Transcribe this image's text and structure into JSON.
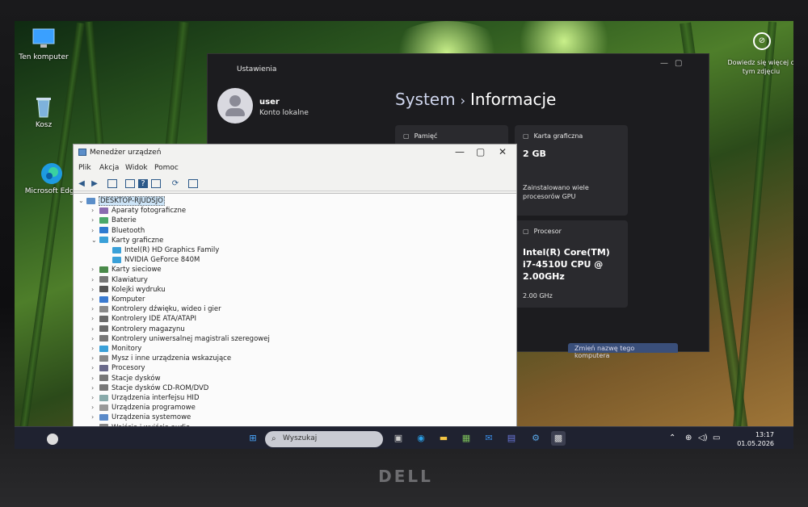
{
  "desktop": {
    "icons": [
      {
        "label": "Ten komputer"
      },
      {
        "label": "Kosz"
      },
      {
        "label": "Microsoft Edge"
      }
    ],
    "spotlight_hint": "Dowiedz się więcej o tym zdjęciu"
  },
  "settings": {
    "window_title": "Ustawienia",
    "user_name": "user",
    "account_type": "Konto lokalne",
    "breadcrumb_parent": "System",
    "breadcrumb_separator": "›",
    "breadcrumb_current": "Informacje",
    "cards": {
      "memory": {
        "label": "Pamięć"
      },
      "gpu": {
        "label": "Karta graficzna",
        "value": "2 GB",
        "note": "Zainstalowano wiele procesorów GPU"
      },
      "cpu": {
        "label": "Procesor",
        "value": "Intel(R) Core(TM) i7-4510U CPU @ 2.00GHz",
        "speed": "2.00 GHz"
      }
    },
    "rename_button": "Zmień nazwę tego komputera"
  },
  "device_manager": {
    "title": "Menedżer urządzeń",
    "menu": [
      "Plik",
      "Akcja",
      "Widok",
      "Pomoc"
    ],
    "tree": [
      {
        "label": "DESKTOP-RJUDSJO",
        "level": 0,
        "expanded": true,
        "selected": true
      },
      {
        "label": "Aparaty fotograficzne",
        "level": 1
      },
      {
        "label": "Baterie",
        "level": 1
      },
      {
        "label": "Bluetooth",
        "level": 1
      },
      {
        "label": "Karty graficzne",
        "level": 1,
        "expanded": true
      },
      {
        "label": "Intel(R) HD Graphics Family",
        "level": 2
      },
      {
        "label": "NVIDIA GeForce 840M",
        "level": 2
      },
      {
        "label": "Karty sieciowe",
        "level": 1
      },
      {
        "label": "Klawiatury",
        "level": 1
      },
      {
        "label": "Kolejki wydruku",
        "level": 1
      },
      {
        "label": "Komputer",
        "level": 1
      },
      {
        "label": "Kontrolery dźwięku, wideo i gier",
        "level": 1
      },
      {
        "label": "Kontrolery IDE ATA/ATAPI",
        "level": 1
      },
      {
        "label": "Kontrolery magazynu",
        "level": 1
      },
      {
        "label": "Kontrolery uniwersalnej magistrali szeregowej",
        "level": 1
      },
      {
        "label": "Monitory",
        "level": 1
      },
      {
        "label": "Mysz i inne urządzenia wskazujące",
        "level": 1
      },
      {
        "label": "Procesory",
        "level": 1
      },
      {
        "label": "Stacje dysków",
        "level": 1
      },
      {
        "label": "Stacje dysków CD-ROM/DVD",
        "level": 1
      },
      {
        "label": "Urządzenia interfejsu HID",
        "level": 1
      },
      {
        "label": "Urządzenia programowe",
        "level": 1
      },
      {
        "label": "Urządzenia systemowe",
        "level": 1
      },
      {
        "label": "Wejścia i wyjścia audio",
        "level": 1
      }
    ]
  },
  "taskbar": {
    "search_placeholder": "Wyszukaj",
    "time": "13:17",
    "date": "01.05.2026"
  },
  "bezel": {
    "brand": "DELL"
  }
}
